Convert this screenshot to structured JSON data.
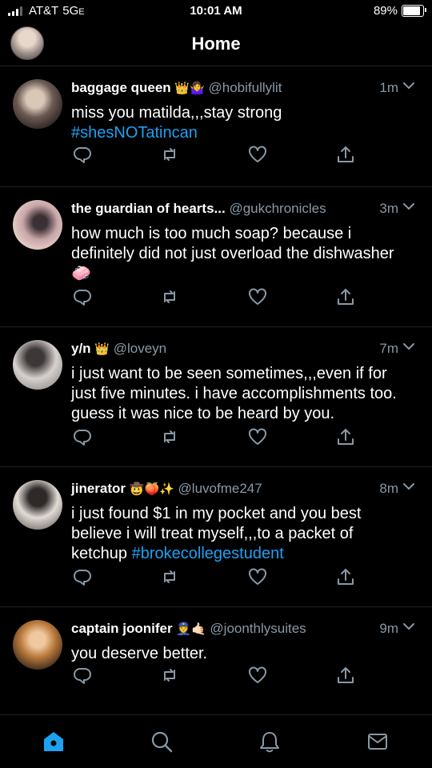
{
  "status_bar": {
    "carrier": "AT&T",
    "network": "5G",
    "network_suffix": "E",
    "time": "10:01 AM",
    "battery_percent": "89%",
    "battery_level": 0.89
  },
  "header": {
    "title": "Home"
  },
  "tweets": [
    {
      "name": "baggage queen",
      "emoji": "👑🤷‍♀️",
      "handle": "@hobifullylit",
      "time": "1m",
      "text": "miss you matilda,,,stay strong",
      "hashtag": "#shesNOTatincan",
      "hashtag_newline": true
    },
    {
      "name": "the guardian of hearts...",
      "emoji": "",
      "handle": "@gukchronicles",
      "time": "3m",
      "text": "how much is too much soap? because i definitely did not just overload the dishwasher 🧼",
      "hashtag": ""
    },
    {
      "name": "y/n",
      "emoji": "👑",
      "handle": "@loveyn",
      "time": "7m",
      "text": "i just want to be seen sometimes,,,even if for just five minutes. i have accomplishments too. guess it was nice to be heard by you.",
      "hashtag": ""
    },
    {
      "name": "jinerator",
      "emoji": "🤠🍑✨",
      "handle": "@luvofme247",
      "time": "8m",
      "text": "i just found $1 in my pocket and you best believe i will treat myself,,,to a packet of ketchup ",
      "hashtag": "#brokecollegestudent"
    },
    {
      "name": "captain joonifer",
      "emoji": "👮🤙🏻",
      "handle": "@joonthlysuites",
      "time": "9m",
      "text": "you deserve better.",
      "hashtag": ""
    }
  ],
  "colors": {
    "accent": "#1da1f2",
    "muted": "#8899a6",
    "background": "#000000"
  },
  "icons": {
    "actions": [
      "reply-icon",
      "retweet-icon",
      "like-icon",
      "share-icon"
    ],
    "tabs": [
      "home-icon",
      "search-icon",
      "notifications-icon",
      "messages-icon"
    ]
  }
}
